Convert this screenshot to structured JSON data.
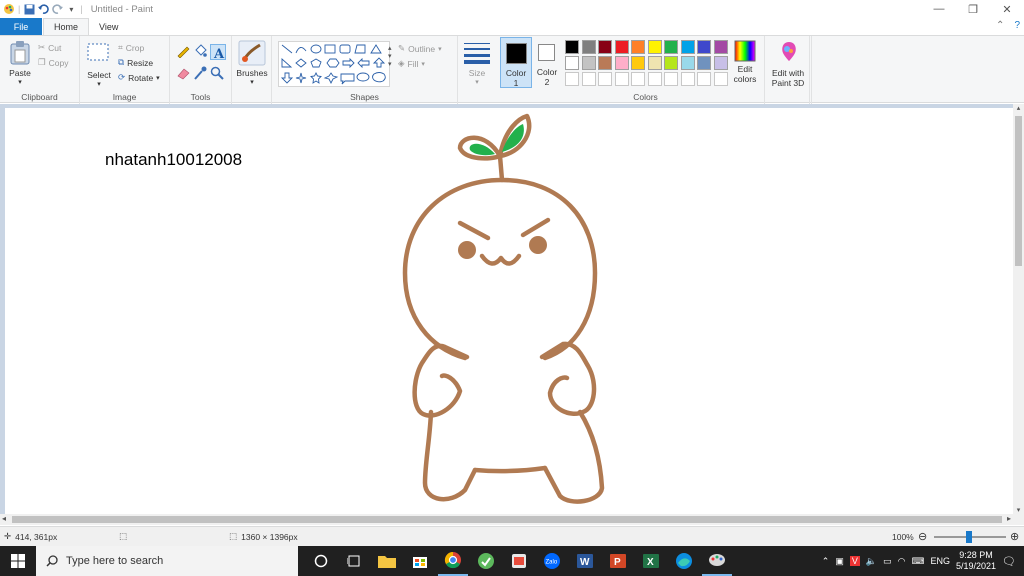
{
  "window": {
    "title": "Untitled - Paint",
    "controls": {
      "minimize": "—",
      "restore": "❐",
      "close": "✕"
    }
  },
  "tabs": {
    "file": "File",
    "home": "Home",
    "view": "View"
  },
  "ribbon": {
    "clipboard": {
      "paste": "Paste",
      "cut": "Cut",
      "copy": "Copy",
      "label": "Clipboard"
    },
    "image": {
      "select": "Select",
      "crop": "Crop",
      "resize": "Resize",
      "rotate": "Rotate",
      "label": "Image"
    },
    "tools": {
      "label": "Tools"
    },
    "brushes": {
      "label": "Brushes"
    },
    "shapes": {
      "outline": "Outline",
      "fill": "Fill",
      "label": "Shapes"
    },
    "size": {
      "label": "Size"
    },
    "color1": {
      "line1": "Color",
      "line2": "1"
    },
    "color2": {
      "line1": "Color",
      "line2": "2"
    },
    "colors": {
      "label": "Colors",
      "row1": [
        "#000000",
        "#7f7f7f",
        "#880015",
        "#ed1c24",
        "#ff7f27",
        "#fff200",
        "#22b14c",
        "#00a2e8",
        "#3f48cc",
        "#a349a4"
      ],
      "row2": [
        "#ffffff",
        "#c3c3c3",
        "#b97a57",
        "#ffaec9",
        "#ffc90e",
        "#efe4b0",
        "#b5e61d",
        "#99d9ea",
        "#7092be",
        "#c8bfe7"
      ],
      "row3": [
        "#ffffff",
        "#ffffff",
        "#ffffff",
        "#ffffff",
        "#ffffff",
        "#ffffff",
        "#ffffff",
        "#ffffff",
        "#ffffff",
        "#ffffff"
      ]
    },
    "edit_colors": {
      "line1": "Edit",
      "line2": "colors"
    },
    "paint3d": {
      "line1": "Edit with",
      "line2": "Paint 3D"
    }
  },
  "canvas": {
    "text": "nhatanh10012008",
    "drawing_color": "#b07a52",
    "leaf_color": "#22b14c"
  },
  "status": {
    "cursor_pos": "414, 361px",
    "image_size": "1360 × 1396px",
    "zoom": "100%"
  },
  "taskbar": {
    "search_placeholder": "Type here to search",
    "language": "ENG",
    "time": "9:28 PM",
    "date": "5/19/2021"
  }
}
